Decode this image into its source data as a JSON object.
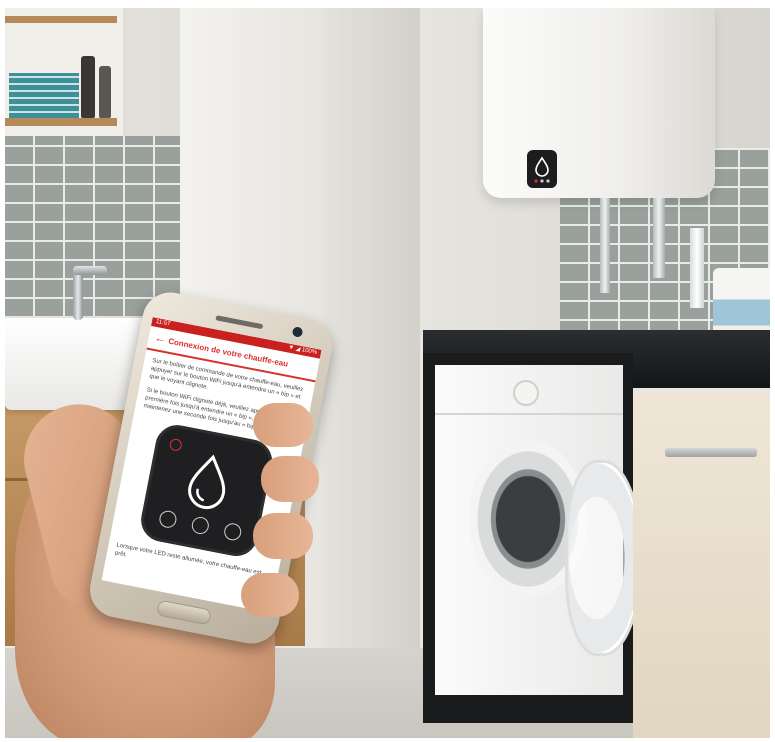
{
  "phone": {
    "status_time": "11:57",
    "status_right": "▼ ◢ 100%",
    "title": "Connexion de votre chauffe-eau",
    "paragraph1": "Sur le boîtier de commande de votre chauffe-eau, veuillez appuyer sur le bouton WiFi jusqu'à entendre un « bip » et que le voyant clignote.",
    "paragraph2": "Si le bouton WiFi clignote déjà, veuillez appuyer une première fois jusqu'à entendre un « bip », relâchez et maintenez une seconde fois jusqu'au « bip ».",
    "footer": "Lorsque votre LED reste allumée, votre chauffe-eau est prêt."
  },
  "colors": {
    "accent_red": "#d7322d"
  },
  "icons": [
    "back-arrow-icon",
    "water-drop-icon"
  ]
}
